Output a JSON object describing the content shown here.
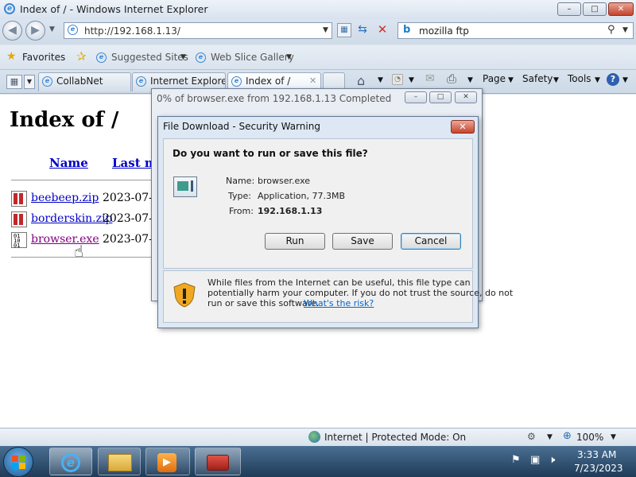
{
  "window": {
    "title": "Index of / - Windows Internet Explorer",
    "min": "–",
    "max": "□",
    "close": "✕"
  },
  "nav": {
    "address": "http://192.168.1.13/",
    "search": "mozilla ftp"
  },
  "favorites": {
    "label": "Favorites",
    "suggested": "Suggested Sites",
    "gallery": "Web Slice Gallery"
  },
  "tabs": [
    {
      "label": "CollabNet"
    },
    {
      "label": "Internet Explore..."
    },
    {
      "label": "Index of /"
    }
  ],
  "commandbar": {
    "page": "Page",
    "safety": "Safety",
    "tools": "Tools"
  },
  "page": {
    "heading": "Index of /",
    "columns": {
      "name": "Name",
      "modified": "Last mo"
    },
    "files": [
      {
        "name": "beebeep.zip",
        "date": "2023-07-"
      },
      {
        "name": "borderskin.zip",
        "date": "2023-07-"
      },
      {
        "name": "browser.exe",
        "date": "2023-07-"
      }
    ]
  },
  "progress_dialog": {
    "title": "0% of browser.exe from 192.168.1.13 Completed"
  },
  "security_dialog": {
    "title": "File Download - Security Warning",
    "question": "Do you want to run or save this file?",
    "name_label": "Name:",
    "name_value": "browser.exe",
    "type_label": "Type:",
    "type_value": "Application, 77.3MB",
    "from_label": "From:",
    "from_value": "192.168.1.13",
    "run": "Run",
    "save": "Save",
    "cancel": "Cancel",
    "warning_line1": "While files from the Internet can be useful, this file type can",
    "warning_line2": "potentially harm your computer. If you do not trust the source, do not",
    "warning_line3": "run or save this software.",
    "risk_link": "What's the risk?"
  },
  "statusbar": {
    "zone": "Internet | Protected Mode: On",
    "zoom": "100%"
  },
  "taskbar": {
    "time": "3:33 AM",
    "date": "7/23/2023"
  },
  "colors": {
    "link": "#0000cc",
    "dialog_close": "#c9432c",
    "taskbar": "#2c4a6b"
  }
}
